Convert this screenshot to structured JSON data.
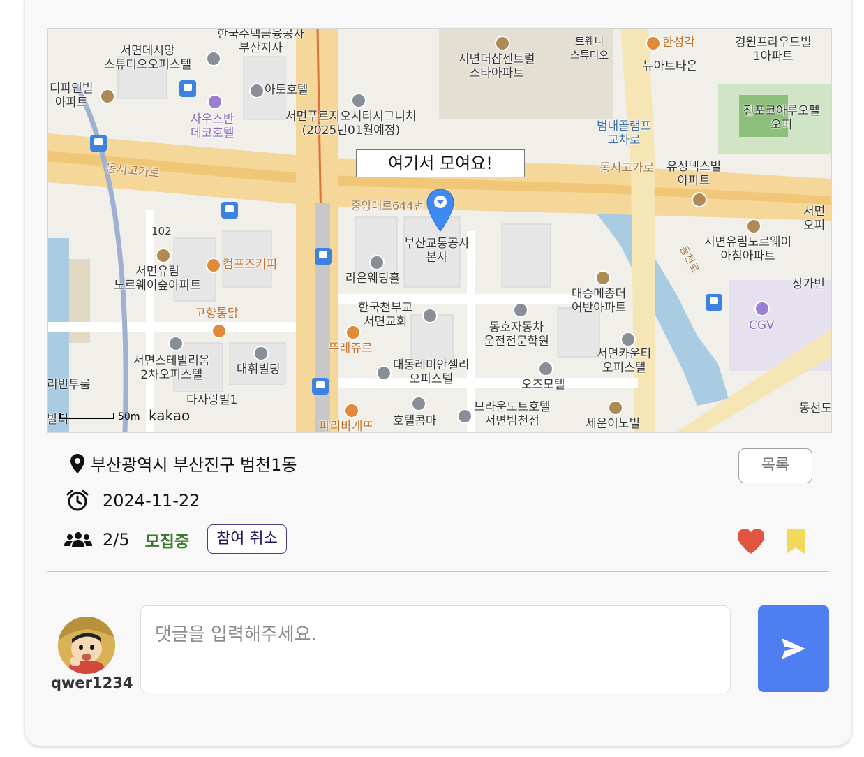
{
  "map": {
    "infowindow": "여기서 모여요!",
    "scale_label": "50m",
    "provider": "kakao",
    "labels": {
      "l1": "서면데시앙\n스튜디오오피스텔",
      "l2": "한국주택금융공사\n부산지사",
      "l3": "아토호텔",
      "l4": "서면더샵센트럴\n스타아파트",
      "l5": "트웨니\n스튜디오",
      "l6": "한성각",
      "l7": "뉴아트타운",
      "l8": "경원프라우드빌\n1아파트",
      "l9": "디파인빌\n아파트",
      "l10": "사우스반\n데코호텔",
      "l11": "서면푸르지오시티시그니처\n(2025년01월예정)",
      "l12": "범내골램프\n교차로",
      "l13": "전포코아루오펠\n오피",
      "l14": "동서고가로",
      "l15": "동서고가로",
      "l16": "유성넥스빌\n아파트",
      "l17": "중앙대로644번",
      "l18": "102",
      "l19": "부산교통공사\n본사",
      "l20": "서면\n오피",
      "l21": "컴포즈커피",
      "l22": "서면유림\n노르웨이숲아파트",
      "l23": "라온웨딩홀",
      "l24": "서면유림노르웨이\n아침아파트",
      "l25": "대승메종더\n어반아파트",
      "l26": "상가번",
      "l27": "동천로",
      "l28": "고향통닭",
      "l29": "한국천부교\n서면교회",
      "l30": "CGV",
      "l31": "동호자동차\n운전전문학원",
      "l32": "뚜레쥬르",
      "l33": "서면스테빌리움\n2차오피스텔",
      "l34": "대휘빌딩",
      "l35": "대동레미안젤리\n오피스텔",
      "l36": "서면카운티\n오피스텔",
      "l37": "오즈모텔",
      "l38": "리빈투룸",
      "l39": "다사랑빌1",
      "l40": "브라운도트호텔\n서면범천점",
      "l41": "호텔콤마",
      "l42": "동천도",
      "l43": "세운이노빌",
      "l44": "파리바게뜨",
      "l45": "발터"
    }
  },
  "info": {
    "address": "부산광역시 부산진구 범천1동",
    "date": "2024-11-22",
    "participants": "2/5",
    "status": "모집중",
    "cancel_label": "참여 취소",
    "list_label": "목록"
  },
  "comment": {
    "username": "qwer1234",
    "placeholder": "댓글을 입력해주세요."
  },
  "colors": {
    "heart": "#e0553f",
    "bookmark": "#f3d95a",
    "send": "#4f7ef0",
    "status": "#3b7a2e"
  },
  "icons": [
    "location-pin-icon",
    "alarm-clock-icon",
    "users-icon",
    "heart-icon",
    "bookmark-icon",
    "send-icon",
    "map-marker-icon",
    "bus-stop-icon"
  ]
}
